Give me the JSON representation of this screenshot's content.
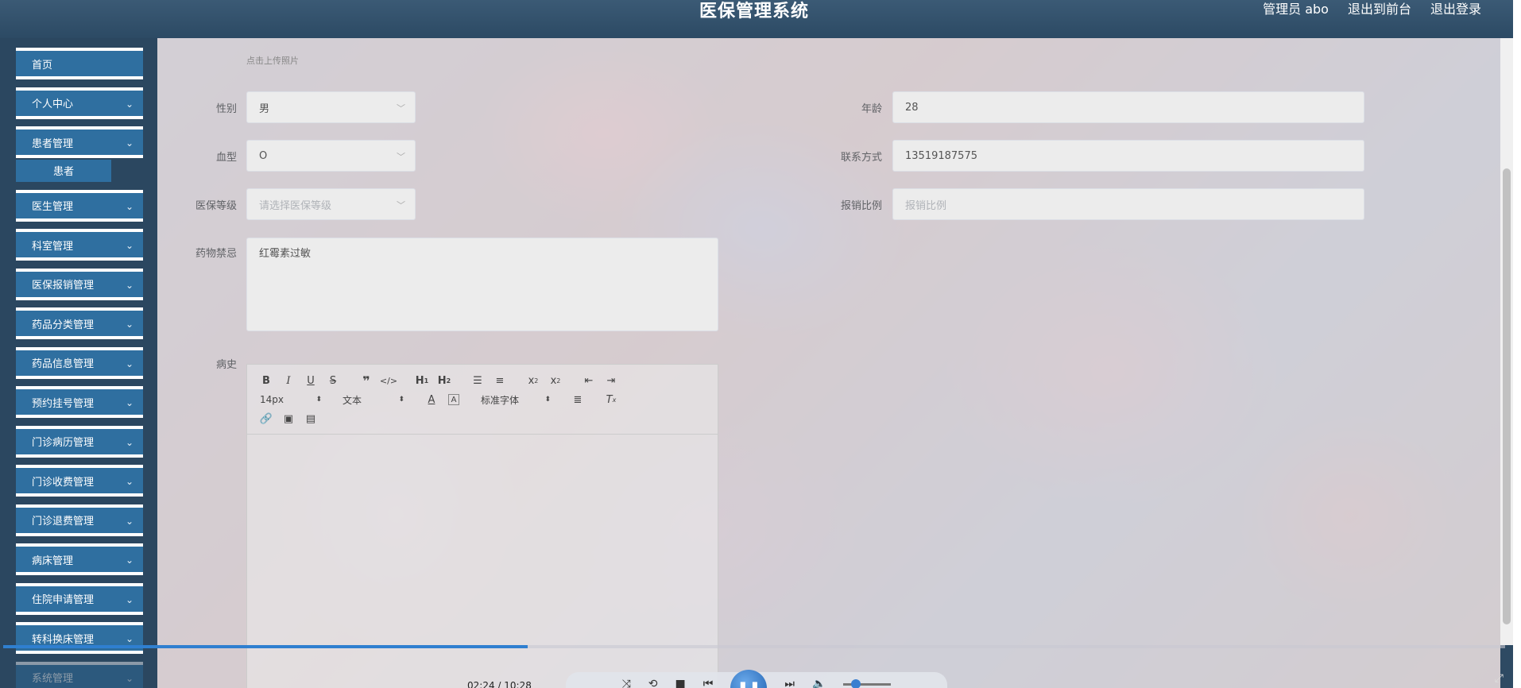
{
  "header": {
    "title": "医保管理系统",
    "user": "管理员 abo",
    "to_front": "退出到前台",
    "logout": "退出登录"
  },
  "sidebar": {
    "items": [
      {
        "label": "首页"
      },
      {
        "label": "个人中心"
      },
      {
        "label": "患者管理"
      },
      {
        "label": "医生管理"
      },
      {
        "label": "科室管理"
      },
      {
        "label": "医保报销管理"
      },
      {
        "label": "药品分类管理"
      },
      {
        "label": "药品信息管理"
      },
      {
        "label": "预约挂号管理"
      },
      {
        "label": "门诊病历管理"
      },
      {
        "label": "门诊收费管理"
      },
      {
        "label": "门诊退费管理"
      },
      {
        "label": "病床管理"
      },
      {
        "label": "住院申请管理"
      },
      {
        "label": "转科换床管理"
      },
      {
        "label": "系统管理"
      }
    ],
    "sub_item": "患者"
  },
  "form": {
    "upload_hint": "点击上传照片",
    "gender": {
      "label": "性别",
      "value": "男"
    },
    "age": {
      "label": "年龄",
      "value": "28"
    },
    "blood": {
      "label": "血型",
      "value": "O"
    },
    "phone": {
      "label": "联系方式",
      "value": "13519187575"
    },
    "level": {
      "label": "医保等级",
      "placeholder": "请选择医保等级"
    },
    "ratio": {
      "label": "报销比例",
      "placeholder": "报销比例"
    },
    "allergy": {
      "label": "药物禁忌",
      "value": "红霉素过敏"
    },
    "history": {
      "label": "病史"
    }
  },
  "editor": {
    "size": "14px",
    "block": "文本",
    "font": "标准字体"
  },
  "player": {
    "time": "02:24 / 10:28"
  }
}
